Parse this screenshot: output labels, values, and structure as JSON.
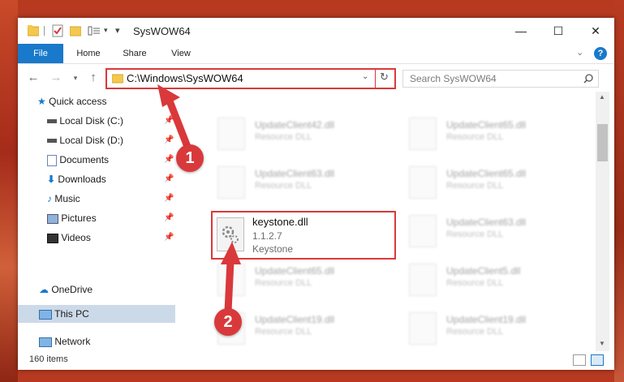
{
  "window": {
    "title": "SysWOW64",
    "controls": {
      "minimize": "—",
      "maximize": "☐",
      "close": "✕"
    }
  },
  "ribbon": {
    "tabs": [
      "File",
      "Home",
      "Share",
      "View"
    ],
    "help": "?"
  },
  "nav": {
    "address": "C:\\Windows\\SysWOW64",
    "search_placeholder": "Search SysWOW64"
  },
  "sidebar": {
    "items": [
      {
        "label": "Quick access",
        "icon": "star-icon"
      },
      {
        "label": "Local Disk (C:)",
        "icon": "drive-icon"
      },
      {
        "label": "Local Disk (D:)",
        "icon": "drive-icon"
      },
      {
        "label": "Documents",
        "icon": "documents-icon"
      },
      {
        "label": "Downloads",
        "icon": "download-icon"
      },
      {
        "label": "Music",
        "icon": "music-icon"
      },
      {
        "label": "Pictures",
        "icon": "pictures-icon"
      },
      {
        "label": "Videos",
        "icon": "videos-icon"
      },
      {
        "label": "OneDrive",
        "icon": "cloud-icon"
      },
      {
        "label": "This PC",
        "icon": "computer-icon"
      },
      {
        "label": "Network",
        "icon": "network-icon"
      }
    ]
  },
  "files": {
    "tiles": [
      {
        "name": "UpdateClient42.dll",
        "desc": "Resource DLL"
      },
      {
        "name": "UpdateClient65.dll",
        "desc": "Resource DLL"
      },
      {
        "name": "UpdateClient63.dll",
        "desc": "Resource DLL"
      },
      {
        "name": "UpdateClient65.dll",
        "desc": "Resource DLL"
      },
      {
        "name": "UpdateClient63.dll",
        "desc": "Resource DLL"
      },
      {
        "name": "UpdateClient65.dll",
        "desc": "Resource DLL"
      },
      {
        "name": "UpdateClient5.dll",
        "desc": "Resource DLL"
      },
      {
        "name": "UpdateClient19.dll",
        "desc": "Resource DLL"
      },
      {
        "name": "UpdateClient19.dll",
        "desc": "Resource DLL"
      }
    ],
    "highlighted": {
      "name": "keystone.dll",
      "version": "1.1.2.7",
      "desc": "Keystone"
    }
  },
  "status": {
    "count": "160 items"
  },
  "callouts": {
    "one": "1",
    "two": "2"
  },
  "colors": {
    "accent": "#1979ca",
    "callout": "#d9393b",
    "selected": "#ccd9e8"
  }
}
